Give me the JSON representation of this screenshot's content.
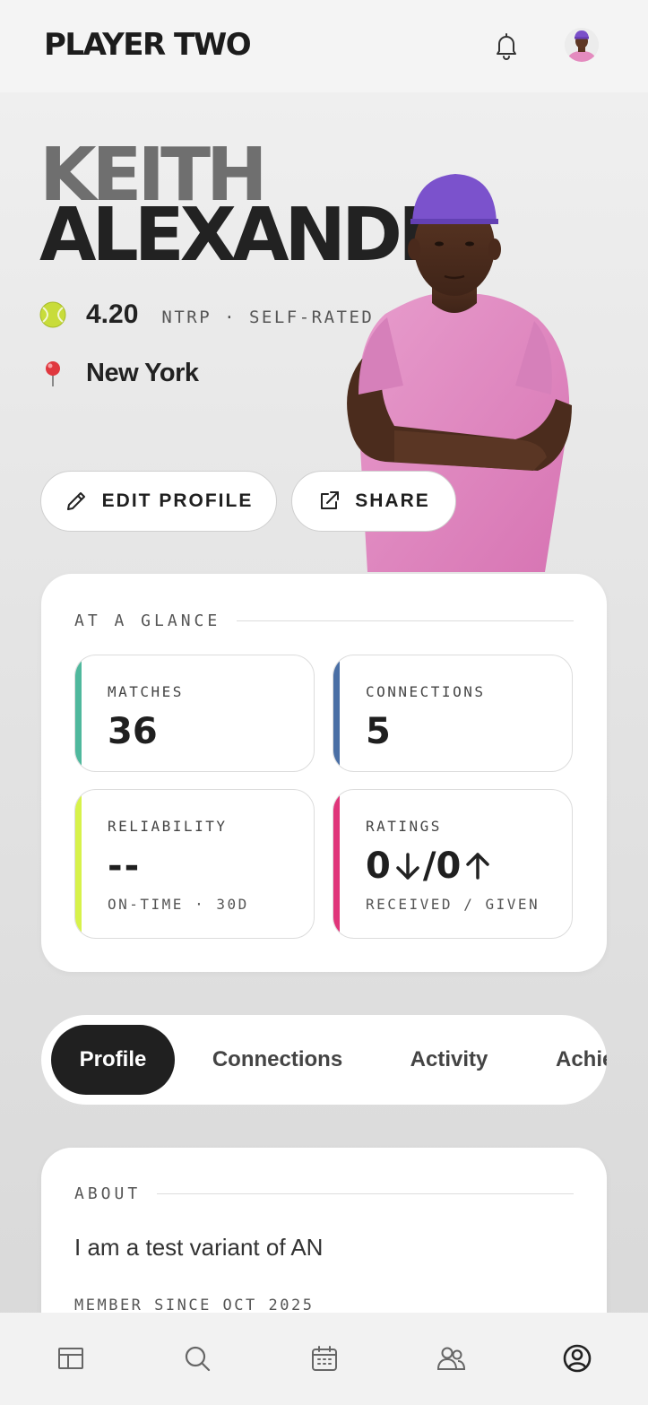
{
  "header": {
    "logo": "PLAYER TWO"
  },
  "profile": {
    "first_name": "KEITH",
    "last_name": "ALEXANDER",
    "rating": "4.20",
    "rating_label": "NTRP · SELF-RATED",
    "location": "New York"
  },
  "actions": {
    "edit": "EDIT PROFILE",
    "share": "SHARE"
  },
  "glance": {
    "title": "AT A GLANCE",
    "stats": [
      {
        "label": "MATCHES",
        "value": "36",
        "accent": "#4fb89d"
      },
      {
        "label": "CONNECTIONS",
        "value": "5",
        "accent": "#4a6fa5"
      },
      {
        "label": "RELIABILITY",
        "value": "--",
        "sub": "ON-TIME · 30D",
        "accent": "#d7f24a"
      },
      {
        "label": "RATINGS",
        "received": "0",
        "separator": "/",
        "given": "0",
        "sub": "RECEIVED / GIVEN",
        "accent": "#e0357a"
      }
    ]
  },
  "tabs": [
    "Profile",
    "Connections",
    "Activity",
    "Achievements"
  ],
  "active_tab": "Profile",
  "about": {
    "title": "ABOUT",
    "text": "I am a test variant of AN",
    "member_since": "MEMBER SINCE OCT 2025"
  },
  "bottom_nav": [
    "dashboard-icon",
    "search-icon",
    "calendar-icon",
    "people-icon",
    "account-icon"
  ]
}
